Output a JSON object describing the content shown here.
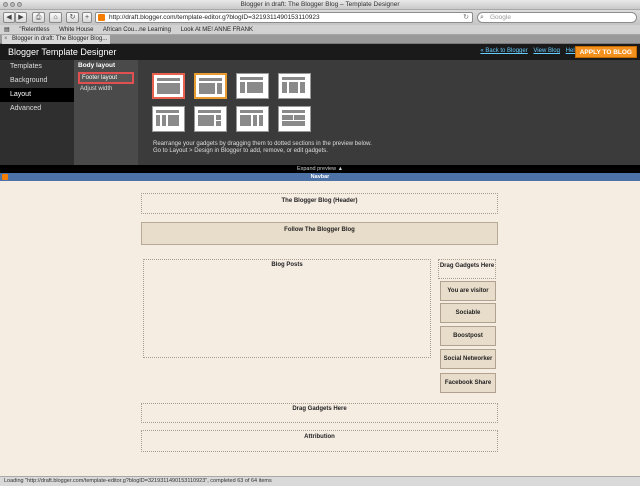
{
  "browser": {
    "window_title": "Blogger in draft: The Blogger Blog – Template Designer",
    "url": "http://draft.blogger.com/template-editor.g?blogID=3219311490153110923",
    "search_placeholder": "Google",
    "bookmarks": [
      "\"Relentless",
      "White House",
      "African Cou...ne Learning",
      "Look At ME! ANNE FRANK"
    ],
    "tab_title": "Blogger in draft: The Blogger Blog...",
    "status": "Loading \"http://draft.blogger.com/template-editor.g?blogID=3219311490153110923\", completed 63 of 64 items"
  },
  "designer": {
    "title": "Blogger Template Designer",
    "links": [
      "« Back to Blogger",
      "View Blog",
      "Help"
    ],
    "apply_label": "APPLY TO BLOG",
    "nav": [
      "Templates",
      "Background",
      "Layout",
      "Advanced"
    ],
    "active_nav": "Layout",
    "sub_heading": "Body layout",
    "sub_items": [
      "Footer layout",
      "Adjust width"
    ],
    "selected_sub": "Footer layout",
    "instructions_line1": "Rearrange your gadgets by dragging them to dotted sections in the preview below.",
    "instructions_line2": "Go to Layout > Design in Blogger to add, remove, or edit gadgets.",
    "expand_label": "Expand preview"
  },
  "preview": {
    "navbar_label": "Navbar",
    "header": "The Blogger Blog (Header)",
    "follow": "Follow The Blogger Blog",
    "blog_posts": "Blog Posts",
    "sidebar_drag": "Drag Gadgets Here",
    "sidebar_gadgets": [
      "You are visitor",
      "Sociable",
      "Boostpost",
      "Social Networker",
      "Facebook Share"
    ],
    "footer_drag": "Drag Gadgets Here",
    "attribution": "Attribution"
  },
  "colors": {
    "apply_button": "#f4901e",
    "navbar": "#4d72a8",
    "preview_bg": "#f5ece2",
    "selected_outline": "#e05050"
  }
}
